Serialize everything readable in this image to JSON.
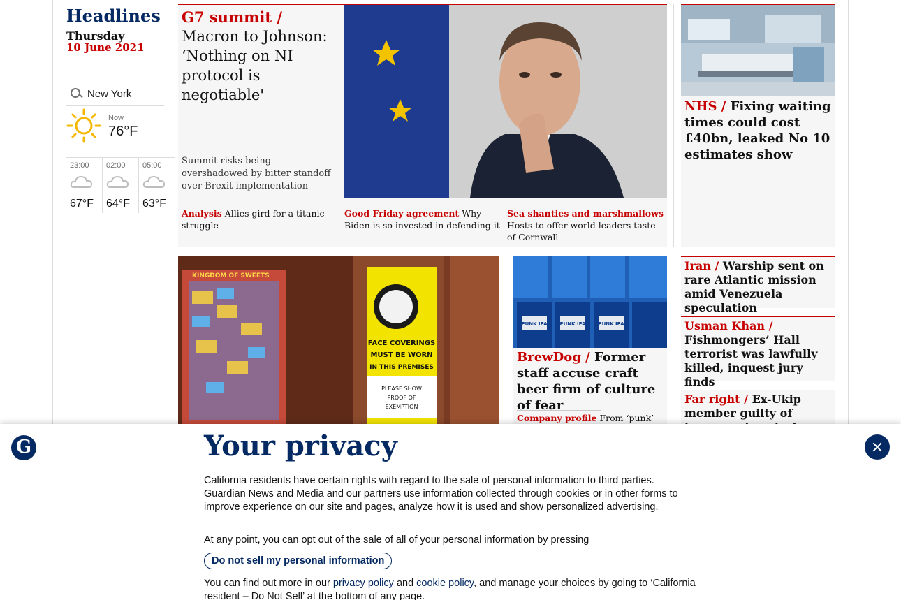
{
  "headlines": {
    "title": "Headlines",
    "day": "Thursday",
    "date": "10 June 2021"
  },
  "weather": {
    "location": "New York",
    "now_label": "Now",
    "now_temp": "76°F",
    "forecast": [
      {
        "time": "23:00",
        "temp": "67°F"
      },
      {
        "time": "02:00",
        "temp": "64°F"
      },
      {
        "time": "05:00",
        "temp": "63°F"
      }
    ]
  },
  "top_story": {
    "kicker": "G7 summit /",
    "headline": "Macron to Johnson: ‘Nothing on NI protocol is negotiable'",
    "standfirst": "Summit risks being overshadowed by bitter standoff over Brexit implementation",
    "sublinks": [
      {
        "kicker": "Analysis",
        "text": "Allies gird for a titanic struggle"
      },
      {
        "kicker": "Good Friday agreement",
        "text": "Why Biden is so invested in defending it"
      },
      {
        "kicker": "Sea shanties and marshmallows",
        "text": "Hosts to offer world leaders taste of Cornwall"
      }
    ]
  },
  "nhs_story": {
    "kicker": "NHS /",
    "headline": "Fixing waiting times could cost £40bn, leaked No 10 estimates show"
  },
  "brewdog_story": {
    "kicker": "BrewDog /",
    "headline": "Former staff accuse craft beer firm of culture of fear",
    "sub_kicker": "Company profile",
    "sub_text": "From ‘punk’"
  },
  "mini_stories": [
    {
      "kicker": "Iran /",
      "headline": "Warship sent on rare Atlantic mission amid Venezuela speculation"
    },
    {
      "kicker": "Usman Khan /",
      "headline": "Fishmongers’ Hall terrorist was lawfully killed, inquest jury finds"
    },
    {
      "kicker": "Far right /",
      "headline": "Ex-Ukip member guilty of terror and explosives offences"
    }
  ],
  "images": {
    "shop_sign": [
      "FACE COVERINGS",
      "MUST BE WORN",
      "IN THIS PREMISES",
      "PLEASE SHOW",
      "PROOF OF",
      "EXEMPTION"
    ],
    "shop_name": "KINGDOM OF SWEETS",
    "cans_label": "PUNK IPA"
  },
  "privacy": {
    "logo": "G",
    "title": "Your privacy",
    "para1": "California residents have certain rights with regard to the sale of personal information to third parties. Guardian News and Media and our partners use information collected through cookies or in other forms to improve experience on our site and pages, analyze how it is used and show personalized advertising.",
    "para2": "At any point, you can opt out of the sale of all of your personal information by pressing",
    "button": "Do not sell my personal information",
    "para3_start": "You can find out more in our",
    "privacy_link": "privacy policy",
    "and": "and",
    "cookie_link": "cookie policy",
    "para3_end": ", and manage your choices by going to ‘California resident – Do Not Sell’ at the bottom of any page."
  },
  "colors": {
    "brand_blue": "#052962",
    "news_red": "#c70000",
    "card_bg": "#f6f6f6"
  }
}
